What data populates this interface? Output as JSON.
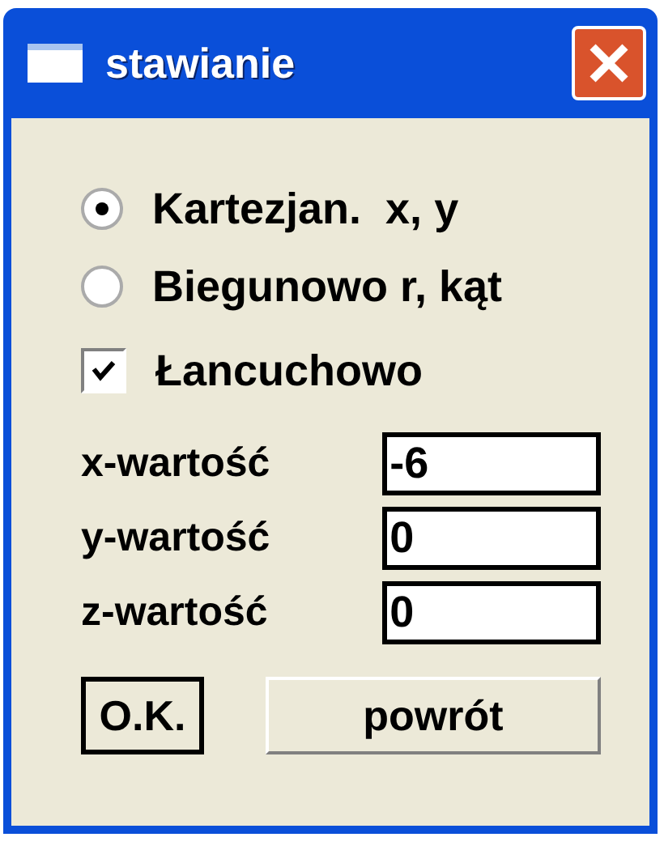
{
  "window": {
    "title": "stawianie"
  },
  "modes": [
    {
      "label": "Kartezjan.  x, y",
      "selected": true
    },
    {
      "label": "Biegunowo r, kąt",
      "selected": false
    }
  ],
  "chain": {
    "label": "Łancuchowo",
    "checked": true
  },
  "fields": [
    {
      "label": "x-wartość",
      "value": "-6"
    },
    {
      "label": "y-wartość",
      "value": "0"
    },
    {
      "label": "z-wartość",
      "value": "0"
    }
  ],
  "buttons": [
    {
      "label": "O.K.",
      "default": true
    },
    {
      "label": "powrót",
      "default": false
    }
  ]
}
